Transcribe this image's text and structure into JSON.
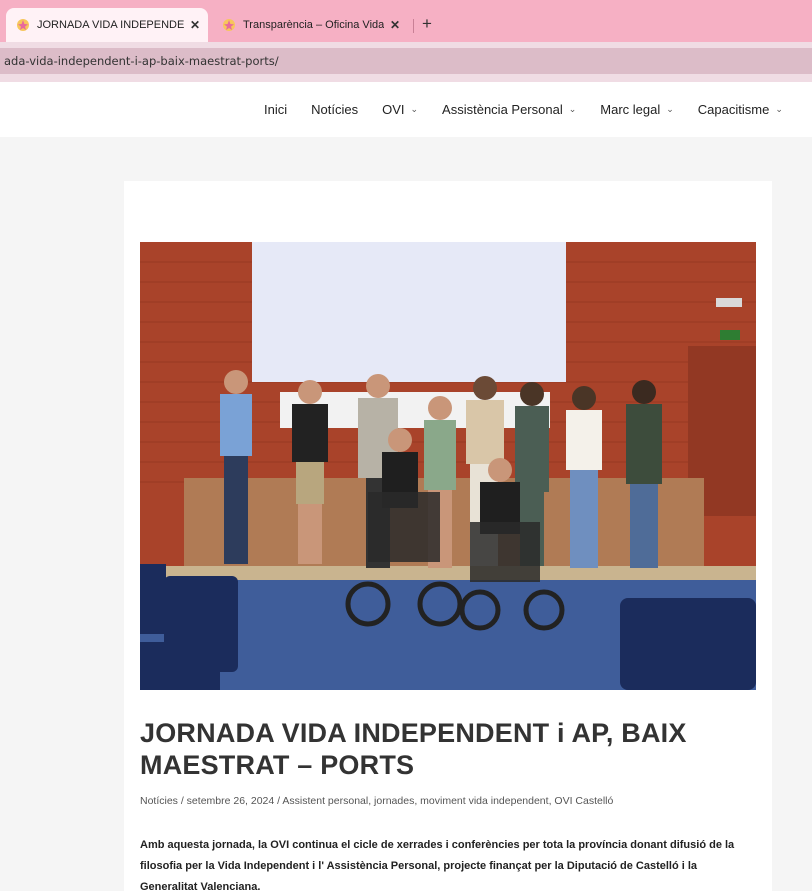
{
  "browser": {
    "tabs": [
      {
        "title": "JORNADA VIDA INDEPENDENT",
        "close": "✕"
      },
      {
        "title": "Transparència – Oficina Vida Ind",
        "close": "✕"
      }
    ],
    "new_tab": "+",
    "url": "ada-vida-independent-i-ap-baix-maestrat-ports/"
  },
  "nav": {
    "items": [
      {
        "label": "Inici",
        "chevron": ""
      },
      {
        "label": "Notícies",
        "chevron": ""
      },
      {
        "label": "OVI",
        "chevron": "⌄"
      },
      {
        "label": "Assistència Personal",
        "chevron": "⌄"
      },
      {
        "label": "Marc legal",
        "chevron": "⌄"
      },
      {
        "label": "Capacitisme",
        "chevron": "⌄"
      }
    ]
  },
  "post": {
    "title": "JORNADA VIDA INDEPENDENT i AP, BAIX MAESTRAT – PORTS",
    "meta": "Notícies / setembre 26, 2024 / Assistent personal, jornades, moviment vida independent, OVI Castelló",
    "excerpt": "Amb aquesta jornada, la OVI continua el cicle de xerrades i conferències per tota la província donant difusió de la filosofia per la Vida Independent i l' Assistència Personal, projecte finançat per la Diputació de Castelló i la Generalitat Valenciana.",
    "image_icon": "group-photo-image"
  },
  "colors": {
    "tabbar": "#f6b0c4",
    "urlbar": "#f0dce4",
    "brick": "#a9432a",
    "screen": "#e6e9f7",
    "carpet": "#3f5d9a"
  }
}
